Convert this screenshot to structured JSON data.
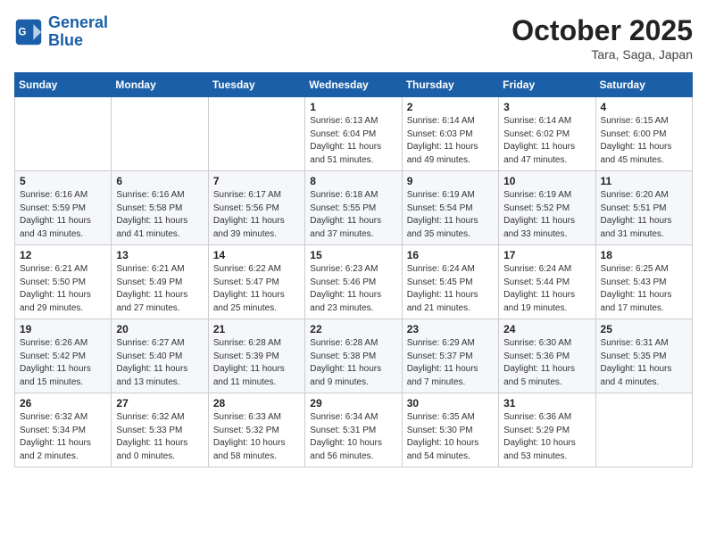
{
  "header": {
    "logo_line1": "General",
    "logo_line2": "Blue",
    "month": "October 2025",
    "location": "Tara, Saga, Japan"
  },
  "weekdays": [
    "Sunday",
    "Monday",
    "Tuesday",
    "Wednesday",
    "Thursday",
    "Friday",
    "Saturday"
  ],
  "weeks": [
    [
      {
        "day": "",
        "info": ""
      },
      {
        "day": "",
        "info": ""
      },
      {
        "day": "",
        "info": ""
      },
      {
        "day": "1",
        "info": "Sunrise: 6:13 AM\nSunset: 6:04 PM\nDaylight: 11 hours and 51 minutes."
      },
      {
        "day": "2",
        "info": "Sunrise: 6:14 AM\nSunset: 6:03 PM\nDaylight: 11 hours and 49 minutes."
      },
      {
        "day": "3",
        "info": "Sunrise: 6:14 AM\nSunset: 6:02 PM\nDaylight: 11 hours and 47 minutes."
      },
      {
        "day": "4",
        "info": "Sunrise: 6:15 AM\nSunset: 6:00 PM\nDaylight: 11 hours and 45 minutes."
      }
    ],
    [
      {
        "day": "5",
        "info": "Sunrise: 6:16 AM\nSunset: 5:59 PM\nDaylight: 11 hours and 43 minutes."
      },
      {
        "day": "6",
        "info": "Sunrise: 6:16 AM\nSunset: 5:58 PM\nDaylight: 11 hours and 41 minutes."
      },
      {
        "day": "7",
        "info": "Sunrise: 6:17 AM\nSunset: 5:56 PM\nDaylight: 11 hours and 39 minutes."
      },
      {
        "day": "8",
        "info": "Sunrise: 6:18 AM\nSunset: 5:55 PM\nDaylight: 11 hours and 37 minutes."
      },
      {
        "day": "9",
        "info": "Sunrise: 6:19 AM\nSunset: 5:54 PM\nDaylight: 11 hours and 35 minutes."
      },
      {
        "day": "10",
        "info": "Sunrise: 6:19 AM\nSunset: 5:52 PM\nDaylight: 11 hours and 33 minutes."
      },
      {
        "day": "11",
        "info": "Sunrise: 6:20 AM\nSunset: 5:51 PM\nDaylight: 11 hours and 31 minutes."
      }
    ],
    [
      {
        "day": "12",
        "info": "Sunrise: 6:21 AM\nSunset: 5:50 PM\nDaylight: 11 hours and 29 minutes."
      },
      {
        "day": "13",
        "info": "Sunrise: 6:21 AM\nSunset: 5:49 PM\nDaylight: 11 hours and 27 minutes."
      },
      {
        "day": "14",
        "info": "Sunrise: 6:22 AM\nSunset: 5:47 PM\nDaylight: 11 hours and 25 minutes."
      },
      {
        "day": "15",
        "info": "Sunrise: 6:23 AM\nSunset: 5:46 PM\nDaylight: 11 hours and 23 minutes."
      },
      {
        "day": "16",
        "info": "Sunrise: 6:24 AM\nSunset: 5:45 PM\nDaylight: 11 hours and 21 minutes."
      },
      {
        "day": "17",
        "info": "Sunrise: 6:24 AM\nSunset: 5:44 PM\nDaylight: 11 hours and 19 minutes."
      },
      {
        "day": "18",
        "info": "Sunrise: 6:25 AM\nSunset: 5:43 PM\nDaylight: 11 hours and 17 minutes."
      }
    ],
    [
      {
        "day": "19",
        "info": "Sunrise: 6:26 AM\nSunset: 5:42 PM\nDaylight: 11 hours and 15 minutes."
      },
      {
        "day": "20",
        "info": "Sunrise: 6:27 AM\nSunset: 5:40 PM\nDaylight: 11 hours and 13 minutes."
      },
      {
        "day": "21",
        "info": "Sunrise: 6:28 AM\nSunset: 5:39 PM\nDaylight: 11 hours and 11 minutes."
      },
      {
        "day": "22",
        "info": "Sunrise: 6:28 AM\nSunset: 5:38 PM\nDaylight: 11 hours and 9 minutes."
      },
      {
        "day": "23",
        "info": "Sunrise: 6:29 AM\nSunset: 5:37 PM\nDaylight: 11 hours and 7 minutes."
      },
      {
        "day": "24",
        "info": "Sunrise: 6:30 AM\nSunset: 5:36 PM\nDaylight: 11 hours and 5 minutes."
      },
      {
        "day": "25",
        "info": "Sunrise: 6:31 AM\nSunset: 5:35 PM\nDaylight: 11 hours and 4 minutes."
      }
    ],
    [
      {
        "day": "26",
        "info": "Sunrise: 6:32 AM\nSunset: 5:34 PM\nDaylight: 11 hours and 2 minutes."
      },
      {
        "day": "27",
        "info": "Sunrise: 6:32 AM\nSunset: 5:33 PM\nDaylight: 11 hours and 0 minutes."
      },
      {
        "day": "28",
        "info": "Sunrise: 6:33 AM\nSunset: 5:32 PM\nDaylight: 10 hours and 58 minutes."
      },
      {
        "day": "29",
        "info": "Sunrise: 6:34 AM\nSunset: 5:31 PM\nDaylight: 10 hours and 56 minutes."
      },
      {
        "day": "30",
        "info": "Sunrise: 6:35 AM\nSunset: 5:30 PM\nDaylight: 10 hours and 54 minutes."
      },
      {
        "day": "31",
        "info": "Sunrise: 6:36 AM\nSunset: 5:29 PM\nDaylight: 10 hours and 53 minutes."
      },
      {
        "day": "",
        "info": ""
      }
    ]
  ]
}
